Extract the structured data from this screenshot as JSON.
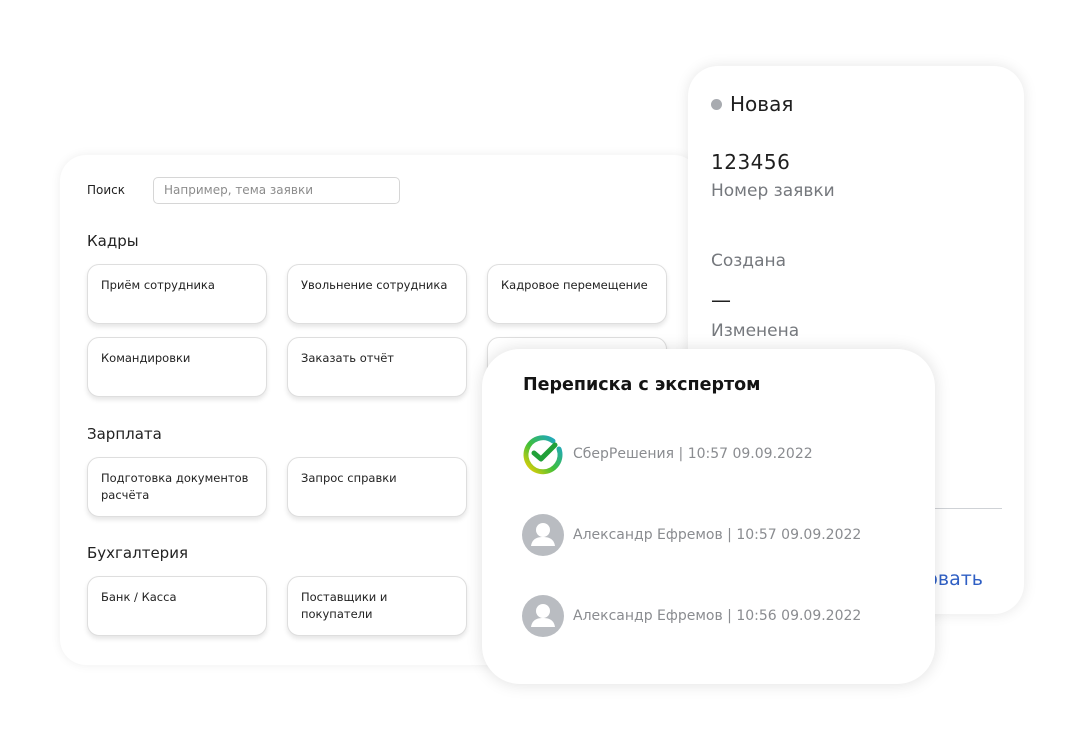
{
  "search": {
    "label": "Поиск",
    "placeholder": "Например, тема заявки",
    "value": ""
  },
  "sections": [
    {
      "title": "Кадры",
      "cards": [
        "Приём сотрудника",
        "Увольнение сотрудника",
        "Кадровое перемещение",
        "Командировки",
        "Заказать отчёт"
      ]
    },
    {
      "title": "Зарплата",
      "cards": [
        "Подготовка документов расчёта",
        "Запрос справки"
      ]
    },
    {
      "title": "Бухгалтерия",
      "cards": [
        "Банк / Касса",
        "Поставщики и покупатели"
      ]
    }
  ],
  "request": {
    "status": "Новая",
    "status_color": "#a8abb0",
    "number": "123456",
    "number_label": "Номер заявки",
    "created_label": "Создана",
    "created_value": "—",
    "modified_label": "Изменена",
    "action_label": "овать",
    "action_color": "#2f5fc4"
  },
  "chat": {
    "title": "Переписка с экспертом",
    "messages": [
      {
        "author": "СберРешения",
        "time": "10:57 09.09.2022",
        "avatar": "sber-logo-icon"
      },
      {
        "author": "Александр Ефремов",
        "time": "10:57 09.09.2022",
        "avatar": "user-avatar-icon"
      },
      {
        "author": "Александр Ефремов",
        "time": "10:56 09.09.2022",
        "avatar": "user-avatar-icon"
      }
    ]
  }
}
